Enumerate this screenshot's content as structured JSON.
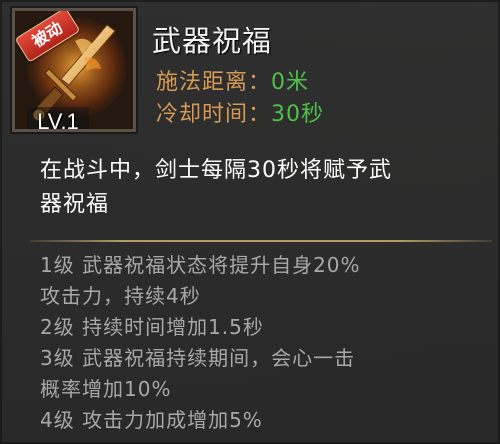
{
  "skill": {
    "title": "武器祝福",
    "badge": "被动",
    "level": "LV.1",
    "icon": "sword-skill-icon",
    "range_label": "施法距离：",
    "range_value": "0米",
    "cooldown_label": "冷却时间：",
    "cooldown_value": "30秒"
  },
  "description": [
    "在战斗中，剑士每隔30秒将赋予武",
    "器祝福"
  ],
  "levels": [
    "1级 武器祝福状态将提升自身20%",
    "攻击力，持续4秒",
    "2级 持续时间增加1.5秒",
    "3级 武器祝福持续期间，会心一击",
    "概率增加10%",
    "4级 攻击力加成增加5%"
  ],
  "colors": {
    "stat_label": "#d69a54",
    "stat_value": "#4fc04a",
    "badge_red": "#d43a2c",
    "divider": "#b59a68"
  }
}
